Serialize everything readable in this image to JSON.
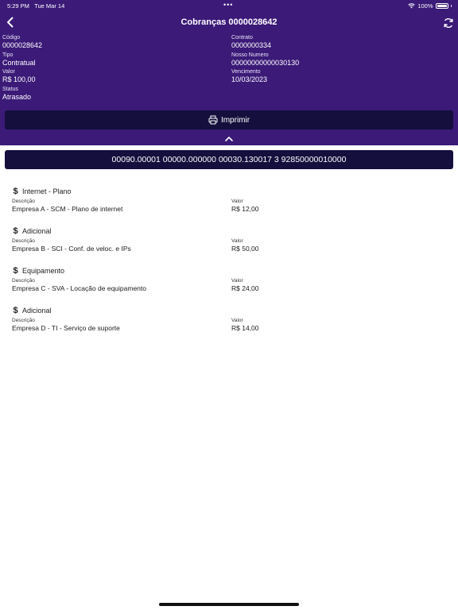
{
  "status_bar": {
    "time": "5:29 PM",
    "date": "Tue Mar 14",
    "dots": "•••",
    "battery": "100%"
  },
  "nav": {
    "title": "Cobranças 0000028642"
  },
  "info": {
    "codigo": {
      "label": "Código",
      "value": "0000028642"
    },
    "contrato": {
      "label": "Contrato",
      "value": "0000000334"
    },
    "tipo": {
      "label": "Tipo",
      "value": "Contratual"
    },
    "nosso_numero": {
      "label": "Nosso Numero",
      "value": "00000000000030130"
    },
    "valor": {
      "label": "Valor",
      "value": "R$ 100,00"
    },
    "vencimento": {
      "label": "Vencimento",
      "value": "10/03/2023"
    },
    "status": {
      "label": "Status",
      "value": "Atrasado"
    }
  },
  "print_button": {
    "label": "Imprimir"
  },
  "barcode": "00090.00001 00000.000000 00030.130017 3 92850000010000",
  "items": [
    {
      "title": "Internet - Plano",
      "desc_label": "Descrição",
      "desc": "Empresa A - SCM - Plano de internet",
      "value_label": "Valor",
      "value": "R$ 12,00"
    },
    {
      "title": "Adicional",
      "desc_label": "Descrição",
      "desc": "Empresa B - SCI - Conf. de veloc. e IPs",
      "value_label": "Valor",
      "value": "R$ 50,00"
    },
    {
      "title": "Equipamento",
      "desc_label": "Descrição",
      "desc": "Empresa C - SVA - Locação de equipamento",
      "value_label": "Valor",
      "value": "R$ 24,00"
    },
    {
      "title": "Adicional",
      "desc_label": "Descrição",
      "desc": "Empresa D - TI - Serviço de suporte",
      "value_label": "Valor",
      "value": "R$ 14,00"
    }
  ],
  "colors": {
    "header": "#3b1a78",
    "button": "#140f3d",
    "text": "#1c1c1c"
  }
}
